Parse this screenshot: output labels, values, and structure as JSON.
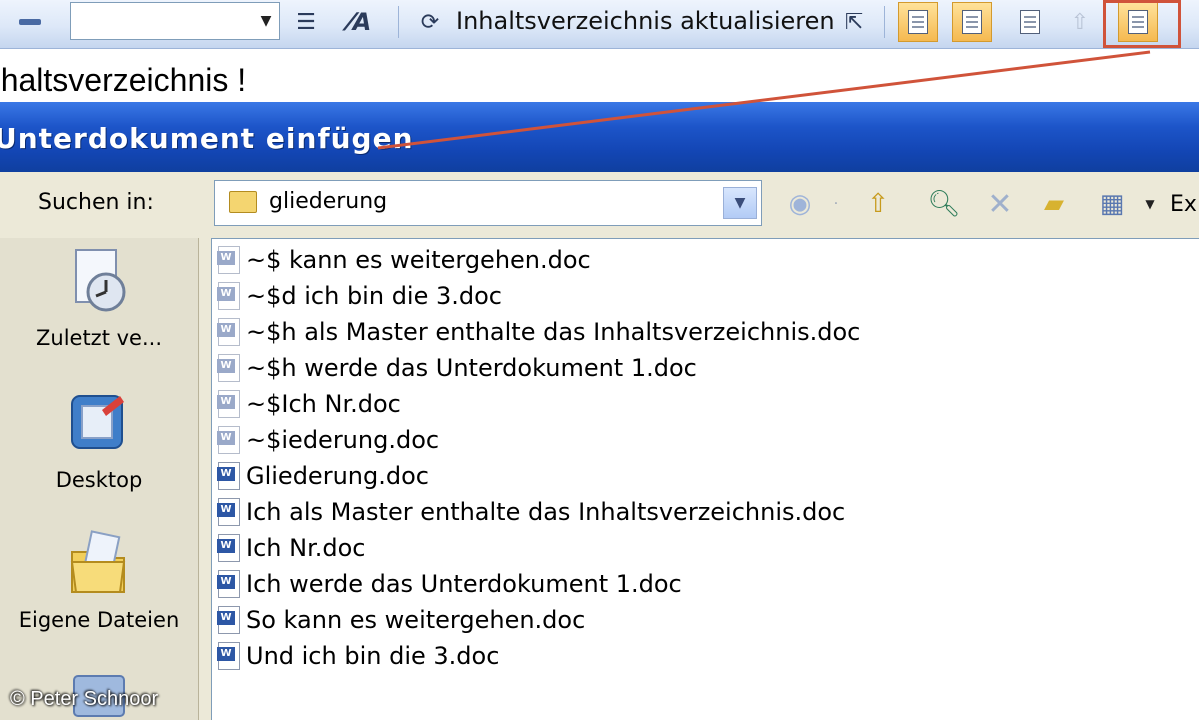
{
  "toolbar": {
    "update_toc_label": "Inhaltsverzeichnis aktualisieren"
  },
  "document": {
    "heading": "Inhaltsverzeichnis !"
  },
  "dialog": {
    "title": "Unterdokument einfügen",
    "look_in_label": "Suchen in:",
    "look_in_value": "gliederung",
    "extras_label": "Ex",
    "places": [
      {
        "label": "Zuletzt ve...",
        "icon": "recent-documents-icon"
      },
      {
        "label": "Desktop",
        "icon": "desktop-icon"
      },
      {
        "label": "Eigene Dateien",
        "icon": "my-documents-icon"
      }
    ],
    "files": [
      {
        "name": "~$ kann es weitergehen.doc",
        "kind": "temp"
      },
      {
        "name": "~$d ich bin die 3.doc",
        "kind": "temp"
      },
      {
        "name": "~$h als Master enthalte das Inhaltsverzeichnis.doc",
        "kind": "temp"
      },
      {
        "name": "~$h werde das Unterdokument 1.doc",
        "kind": "temp"
      },
      {
        "name": "~$Ich Nr.doc",
        "kind": "temp"
      },
      {
        "name": "~$iederung.doc",
        "kind": "temp"
      },
      {
        "name": "Gliederung.doc",
        "kind": "doc"
      },
      {
        "name": "Ich als Master enthalte das Inhaltsverzeichnis.doc",
        "kind": "doc"
      },
      {
        "name": "Ich Nr.doc",
        "kind": "doc"
      },
      {
        "name": "Ich werde das Unterdokument 1.doc",
        "kind": "doc"
      },
      {
        "name": "So kann es weitergehen.doc",
        "kind": "doc"
      },
      {
        "name": "Und ich bin die 3.doc",
        "kind": "doc"
      }
    ]
  },
  "watermark": "© Peter Schnoor",
  "colors": {
    "titlebar": "#1d55c9",
    "dialog_bg": "#ece9d8",
    "annotation_line": "#d0533a"
  }
}
